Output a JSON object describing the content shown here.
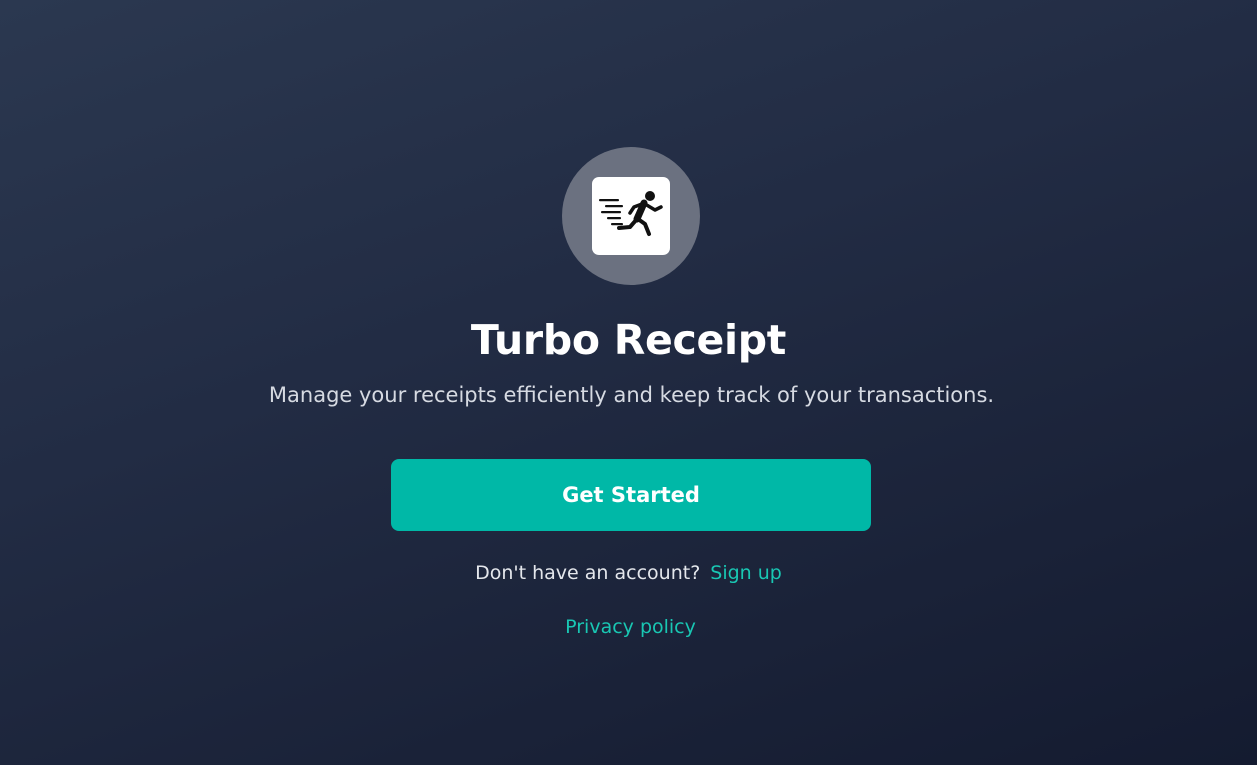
{
  "app": {
    "name": "Turbo Receipt",
    "tagline": "Manage your receipts efficiently and keep track of your transactions.",
    "logo_icon": "running-person-speed-icon"
  },
  "actions": {
    "get_started_label": "Get Started",
    "signup_prompt": "Don't have an account?",
    "signup_label": "Sign up",
    "privacy_label": "Privacy policy"
  },
  "colors": {
    "accent": "#00b8a7",
    "link": "#19c7b3",
    "background_top": "#2b3850",
    "background_bottom": "#141b30",
    "logo_circle": "#6b7180"
  }
}
